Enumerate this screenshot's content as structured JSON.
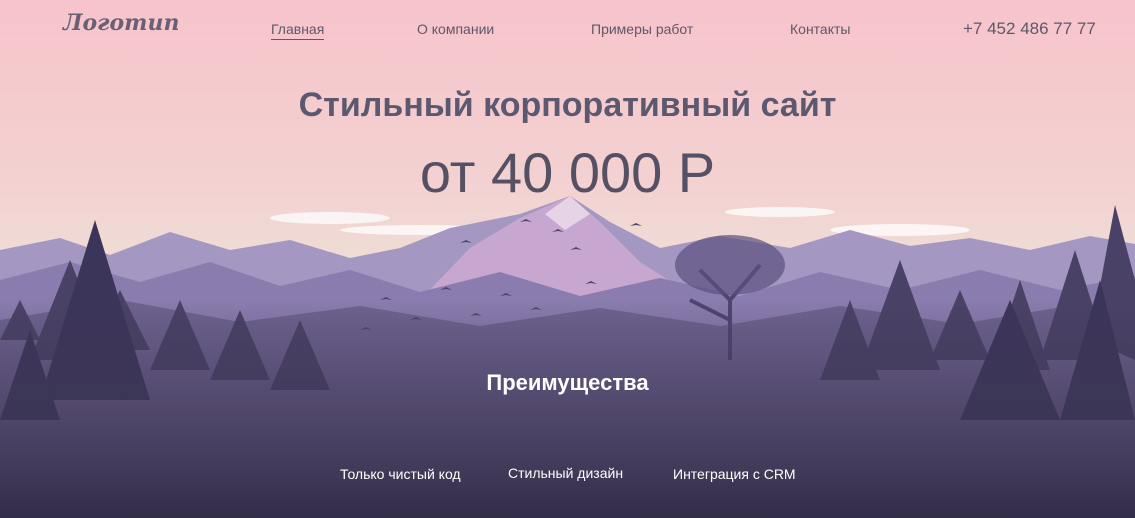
{
  "header": {
    "logo_text": "Логотип",
    "nav": [
      {
        "label": "Главная",
        "active": true
      },
      {
        "label": "О компании",
        "active": false
      },
      {
        "label": "Примеры работ",
        "active": false
      },
      {
        "label": "Контакты",
        "active": false
      }
    ],
    "phone": "+7 452 486 77 77"
  },
  "hero": {
    "title": "Стильный корпоративный сайт",
    "price": "от 40 000 Р"
  },
  "advantages": {
    "title": "Преимущества",
    "items": [
      "Только чистый код",
      "Стильный дизайн",
      "Интеграция с CRM"
    ]
  },
  "colors": {
    "sky_top": "#f7c6cc",
    "sky_bottom": "#f0ddd8",
    "mountains": "#8c7cb0",
    "forest": "#433c5c",
    "text_dark": "#5c5870"
  }
}
